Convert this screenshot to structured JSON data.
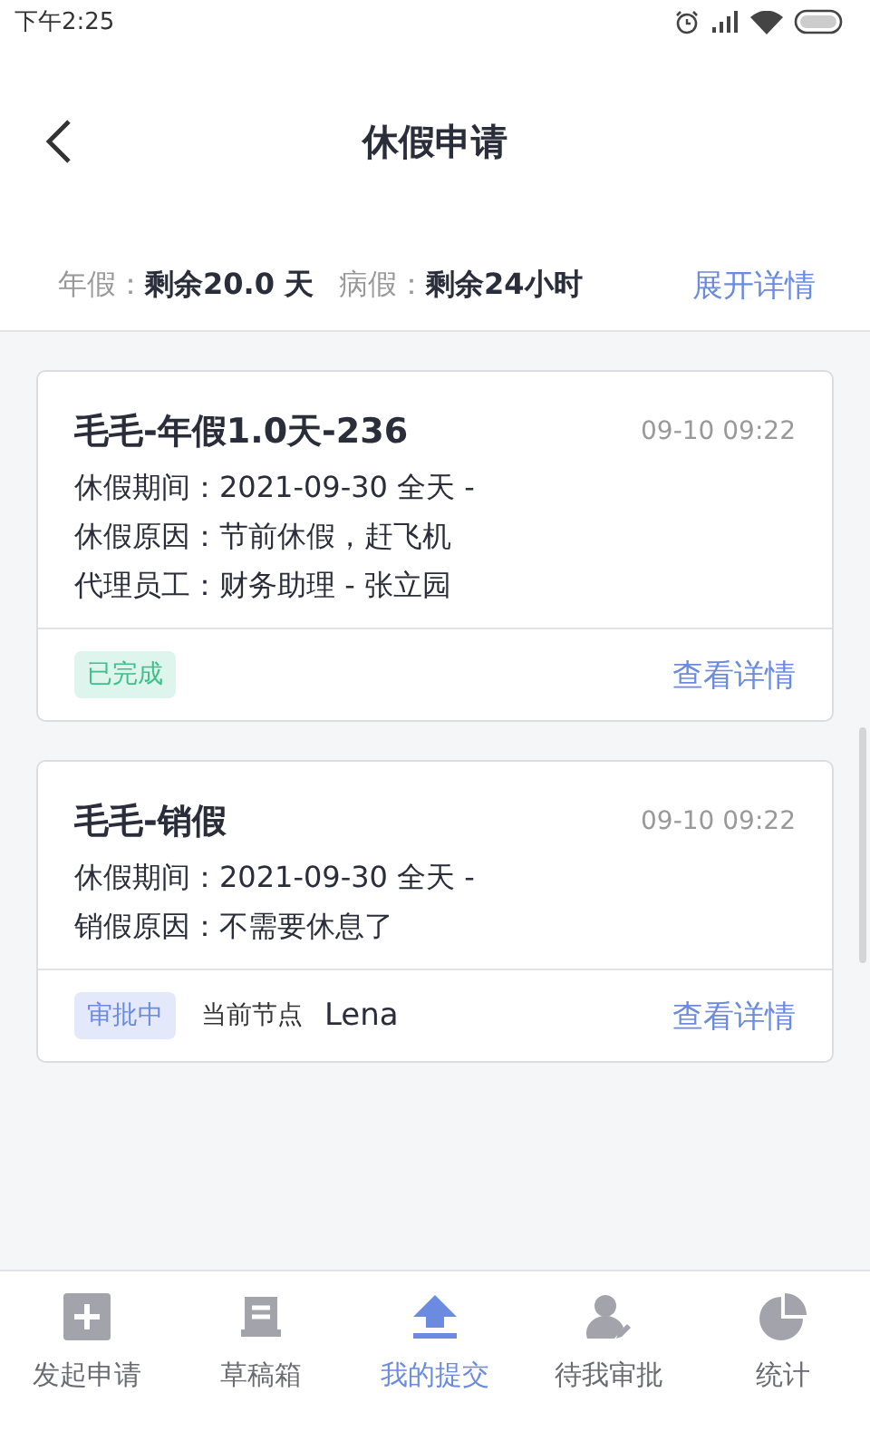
{
  "status_bar": {
    "time": "下午2:25"
  },
  "header": {
    "title": "休假申请"
  },
  "summary": {
    "items": [
      {
        "label": "年假：",
        "value": "剩余20.0 天"
      },
      {
        "label": "病假：",
        "value": "剩余24小时"
      }
    ],
    "link": "展开详情"
  },
  "cards": [
    {
      "title": "毛毛-年假1.0天-236",
      "time": "09-10 09:22",
      "lines": [
        "休假期间：2021-09-30  全天 -",
        "休假原因：节前休假，赶飞机",
        "代理员工：财务助理 - 张立园"
      ],
      "status": {
        "kind": "done",
        "label": "已完成"
      },
      "link": "查看详情"
    },
    {
      "title": "毛毛-销假",
      "time": "09-10 09:22",
      "lines": [
        "休假期间：2021-09-30  全天 -",
        "销假原因：不需要休息了"
      ],
      "status": {
        "kind": "pending",
        "label": "审批中"
      },
      "node_label": "当前节点",
      "node_value": "Lena",
      "link": "查看详情"
    }
  ],
  "tabs": [
    {
      "kind": "plus",
      "label": "发起申请",
      "selected": false
    },
    {
      "kind": "draft",
      "label": "草稿箱",
      "selected": false
    },
    {
      "kind": "upload",
      "label": "我的提交",
      "selected": true
    },
    {
      "kind": "approve",
      "label": "待我审批",
      "selected": false
    },
    {
      "kind": "chart",
      "label": "统计",
      "selected": false
    }
  ]
}
